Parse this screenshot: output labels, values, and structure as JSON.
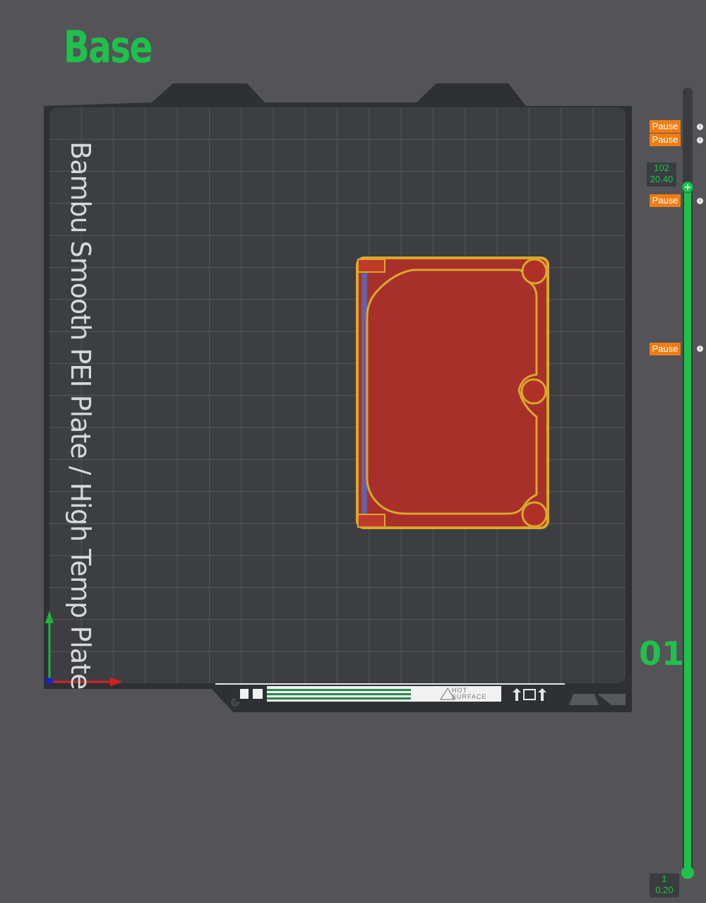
{
  "plate": {
    "name": "Base",
    "type_label": "Bambu Smooth PEI Plate / High Temp Plate",
    "sticker_text": "HOT\nSURFACE",
    "sticker_text_line1": "HOT",
    "sticker_text_line2": "SURFACE"
  },
  "layer_slider": {
    "top_layer": "102",
    "top_height": "20.40",
    "bottom_layer": "1",
    "bottom_height": "0.20",
    "plate_number": "01",
    "pause_markers": [
      "Pause",
      "Pause",
      "Pause",
      "Pause"
    ]
  },
  "colors": {
    "accent_green": "#1ec24a",
    "pause_orange": "#f07d12",
    "part_red": "#a8302b",
    "part_outline": "#d9a82a",
    "bed": "#3a3b3e",
    "x_axis": "#d42020",
    "y_axis": "#1eb43c"
  },
  "icons": [
    "x-axis-icon",
    "y-axis-icon",
    "origin-icon",
    "pause-info-icon",
    "warning-triangle-icon",
    "slider-handle-icon"
  ]
}
